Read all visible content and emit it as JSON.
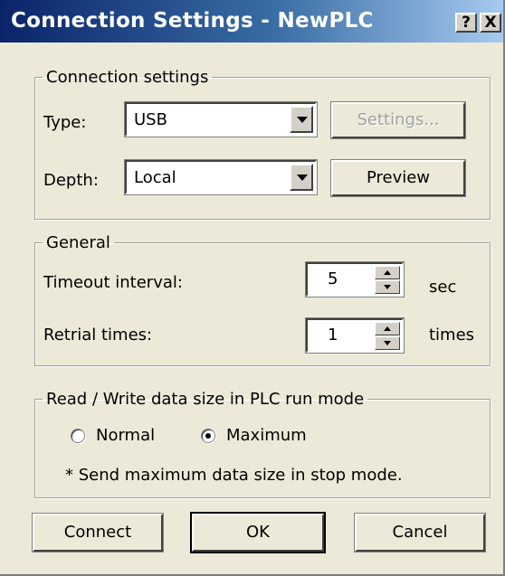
{
  "window": {
    "title": "Connection Settings - NewPLC",
    "help_label": "?",
    "close_label": "X"
  },
  "connection": {
    "legend": "Connection settings",
    "type_label": "Type:",
    "type_value": "USB",
    "depth_label": "Depth:",
    "depth_value": "Local",
    "settings_button": "Settings...",
    "preview_button": "Preview"
  },
  "general": {
    "legend": "General",
    "timeout_label": "Timeout interval:",
    "timeout_value": "5",
    "timeout_unit": "sec",
    "retrial_label": "Retrial times:",
    "retrial_value": "1",
    "retrial_unit": "times"
  },
  "rw": {
    "legend": "Read / Write data size in PLC run mode",
    "options": [
      "Normal",
      "Maximum"
    ],
    "selected": "Maximum",
    "note": "* Send maximum data size in stop mode."
  },
  "buttons": {
    "connect": "Connect",
    "ok": "OK",
    "cancel": "Cancel"
  },
  "colors": {
    "title_start": "#0a246a",
    "title_end": "#a6caf0",
    "face": "#ece9d8"
  }
}
